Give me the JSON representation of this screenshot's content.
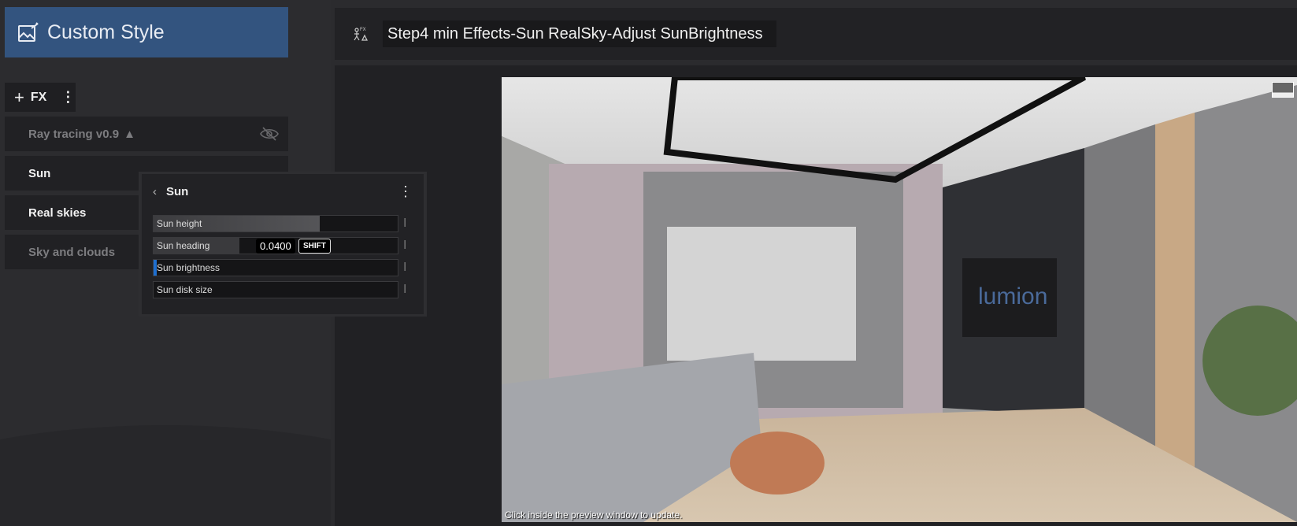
{
  "sidebar": {
    "header_title": "Custom Style",
    "header_icon": "image-sparkle-icon",
    "add_fx_label": "FX",
    "effects": [
      {
        "label": "Ray tracing v0.9",
        "state": "disabled",
        "warning": true
      },
      {
        "label": "Sun",
        "state": "active"
      },
      {
        "label": "Real skies",
        "state": "active"
      },
      {
        "label": "Sky and clouds",
        "state": "disabled"
      }
    ]
  },
  "popup": {
    "title": "Sun",
    "sliders": [
      {
        "label": "Sun height",
        "fill": 0.68
      },
      {
        "label": "Sun heading",
        "fill": 0.35,
        "value": "0.0400",
        "modifier": "SHIFT"
      },
      {
        "label": "Sun brightness",
        "fill": 0.0
      },
      {
        "label": "Sun disk size",
        "fill": 0.0
      }
    ]
  },
  "main": {
    "title": "Step4 min Effects-Sun RealSky-Adjust SunBrightness",
    "preview_hint": "Click inside the preview window to update.",
    "tv_logo": "lumion"
  },
  "colors": {
    "accent": "#33547f",
    "active_slider": "#1e6fd0"
  }
}
